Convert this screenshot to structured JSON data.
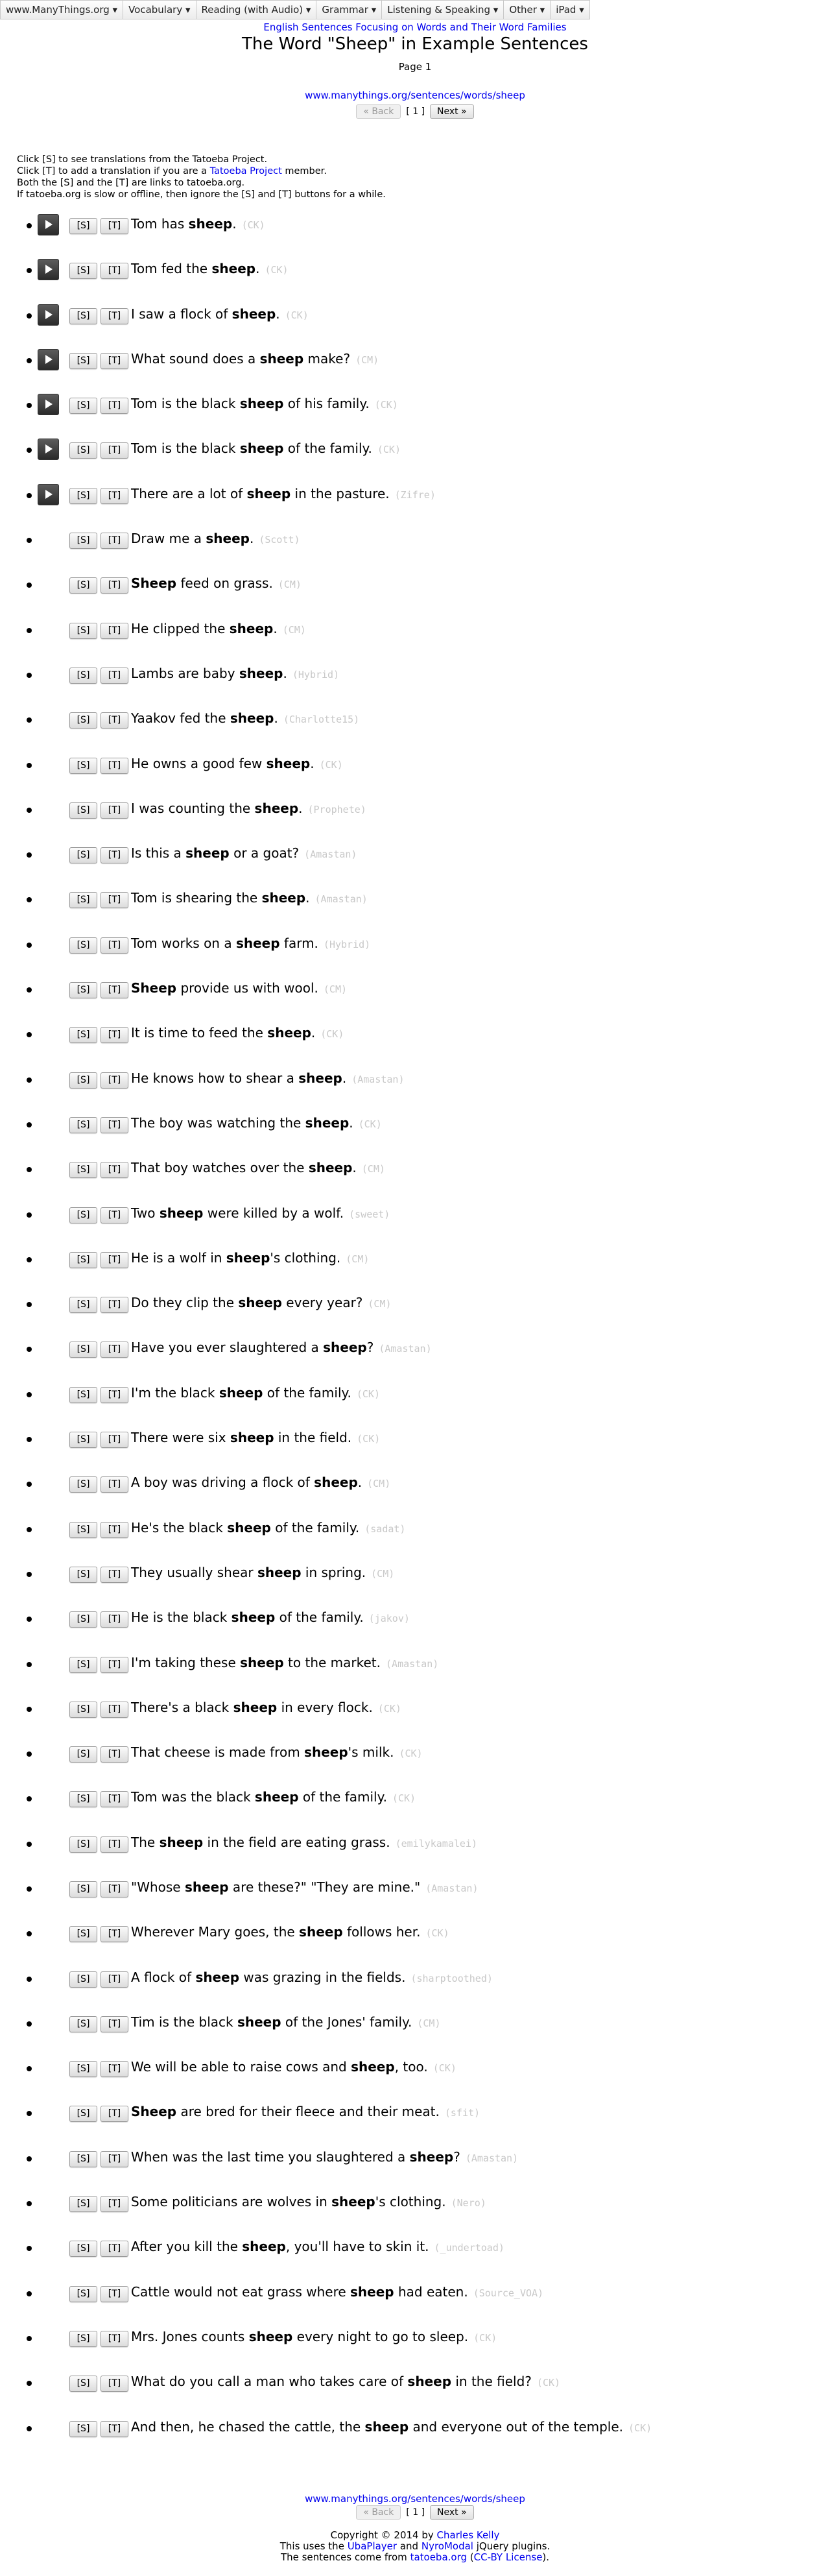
{
  "nav": [
    {
      "label": "www.ManyThings.org ▾"
    },
    {
      "label": "Vocabulary ▾"
    },
    {
      "label": "Reading (with Audio) ▾"
    },
    {
      "label": "Grammar ▾"
    },
    {
      "label": "Listening & Speaking ▾"
    },
    {
      "label": "Other ▾"
    },
    {
      "label": "iPad ▾"
    }
  ],
  "header": {
    "subtitle_link": "English Sentences Focusing on Words and Their Word Families",
    "title": "The Word \"Sheep\" in Example Sentences",
    "page": "Page 1",
    "url": "www.manythings.org/sentences/words/sheep"
  },
  "pager": {
    "back": "« Back",
    "current": "[ 1 ]",
    "next": "Next »"
  },
  "instructions": {
    "line1": "Click [S] to see translations from the Tatoeba Project.",
    "line2_pre": "Click [T] to add a translation if you are a ",
    "line2_link": "Tatoeba Project",
    "line2_post": " member.",
    "line3": "Both the [S] and the [T] are links to tatoeba.org.",
    "line4": "If tatoeba.org is slow or offline, then ignore the [S] and [T] buttons for a while."
  },
  "buttons": {
    "s": "[S]",
    "t": "[T]"
  },
  "sentences": [
    {
      "audio": true,
      "parts": [
        "Tom has ",
        "sheep",
        "."
      ],
      "author": "(CK)"
    },
    {
      "audio": true,
      "parts": [
        "Tom fed the ",
        "sheep",
        "."
      ],
      "author": "(CK)"
    },
    {
      "audio": true,
      "parts": [
        "I saw a flock of ",
        "sheep",
        "."
      ],
      "author": "(CK)"
    },
    {
      "audio": true,
      "parts": [
        "What sound does a ",
        "sheep",
        " make?"
      ],
      "author": "(CM)"
    },
    {
      "audio": true,
      "parts": [
        "Tom is the black ",
        "sheep",
        " of his family."
      ],
      "author": "(CK)"
    },
    {
      "audio": true,
      "parts": [
        "Tom is the black ",
        "sheep",
        " of the family."
      ],
      "author": "(CK)"
    },
    {
      "audio": true,
      "parts": [
        "There are a lot of ",
        "sheep",
        " in the pasture."
      ],
      "author": "(Zifre)"
    },
    {
      "audio": false,
      "parts": [
        "Draw me a ",
        "sheep",
        "."
      ],
      "author": "(Scott)"
    },
    {
      "audio": false,
      "parts": [
        "",
        "Sheep",
        " feed on grass."
      ],
      "author": "(CM)"
    },
    {
      "audio": false,
      "parts": [
        "He clipped the ",
        "sheep",
        "."
      ],
      "author": "(CM)"
    },
    {
      "audio": false,
      "parts": [
        "Lambs are baby ",
        "sheep",
        "."
      ],
      "author": "(Hybrid)"
    },
    {
      "audio": false,
      "parts": [
        "Yaakov fed the ",
        "sheep",
        "."
      ],
      "author": "(Charlotte15)"
    },
    {
      "audio": false,
      "parts": [
        "He owns a good few ",
        "sheep",
        "."
      ],
      "author": "(CK)"
    },
    {
      "audio": false,
      "parts": [
        "I was counting the ",
        "sheep",
        "."
      ],
      "author": "(Prophete)"
    },
    {
      "audio": false,
      "parts": [
        "Is this a ",
        "sheep",
        " or a goat?"
      ],
      "author": "(Amastan)"
    },
    {
      "audio": false,
      "parts": [
        "Tom is shearing the ",
        "sheep",
        "."
      ],
      "author": "(Amastan)"
    },
    {
      "audio": false,
      "parts": [
        "Tom works on a ",
        "sheep",
        " farm."
      ],
      "author": "(Hybrid)"
    },
    {
      "audio": false,
      "parts": [
        "",
        "Sheep",
        " provide us with wool."
      ],
      "author": "(CM)"
    },
    {
      "audio": false,
      "parts": [
        "It is time to feed the ",
        "sheep",
        "."
      ],
      "author": "(CK)"
    },
    {
      "audio": false,
      "parts": [
        "He knows how to shear a ",
        "sheep",
        "."
      ],
      "author": "(Amastan)"
    },
    {
      "audio": false,
      "parts": [
        "The boy was watching the ",
        "sheep",
        "."
      ],
      "author": "(CK)"
    },
    {
      "audio": false,
      "parts": [
        "That boy watches over the ",
        "sheep",
        "."
      ],
      "author": "(CM)"
    },
    {
      "audio": false,
      "parts": [
        "Two ",
        "sheep",
        " were killed by a wolf."
      ],
      "author": "(sweet)"
    },
    {
      "audio": false,
      "parts": [
        "He is a wolf in ",
        "sheep",
        "'s clothing."
      ],
      "author": "(CM)"
    },
    {
      "audio": false,
      "parts": [
        "Do they clip the ",
        "sheep",
        " every year?"
      ],
      "author": "(CM)"
    },
    {
      "audio": false,
      "parts": [
        "Have you ever slaughtered a ",
        "sheep",
        "?"
      ],
      "author": "(Amastan)"
    },
    {
      "audio": false,
      "parts": [
        "I'm the black ",
        "sheep",
        " of the family."
      ],
      "author": "(CK)"
    },
    {
      "audio": false,
      "parts": [
        "There were six ",
        "sheep",
        " in the field."
      ],
      "author": "(CK)"
    },
    {
      "audio": false,
      "parts": [
        "A boy was driving a flock of ",
        "sheep",
        "."
      ],
      "author": "(CM)"
    },
    {
      "audio": false,
      "parts": [
        "He's the black ",
        "sheep",
        " of the family."
      ],
      "author": "(sadat)"
    },
    {
      "audio": false,
      "parts": [
        "They usually shear ",
        "sheep",
        " in spring."
      ],
      "author": "(CM)"
    },
    {
      "audio": false,
      "parts": [
        "He is the black ",
        "sheep",
        " of the family."
      ],
      "author": "(jakov)"
    },
    {
      "audio": false,
      "parts": [
        "I'm taking these ",
        "sheep",
        " to the market."
      ],
      "author": "(Amastan)"
    },
    {
      "audio": false,
      "parts": [
        "There's a black ",
        "sheep",
        " in every flock."
      ],
      "author": "(CK)"
    },
    {
      "audio": false,
      "parts": [
        "That cheese is made from ",
        "sheep",
        "'s milk."
      ],
      "author": "(CK)"
    },
    {
      "audio": false,
      "parts": [
        "Tom was the black ",
        "sheep",
        " of the family."
      ],
      "author": "(CK)"
    },
    {
      "audio": false,
      "parts": [
        "The ",
        "sheep",
        " in the field are eating grass."
      ],
      "author": "(emilykamalei)"
    },
    {
      "audio": false,
      "parts": [
        "\"Whose ",
        "sheep",
        " are these?\" \"They are mine.\""
      ],
      "author": "(Amastan)"
    },
    {
      "audio": false,
      "parts": [
        "Wherever Mary goes, the ",
        "sheep",
        " follows her."
      ],
      "author": "(CK)"
    },
    {
      "audio": false,
      "parts": [
        "A flock of ",
        "sheep",
        " was grazing in the fields."
      ],
      "author": "(sharptoothed)"
    },
    {
      "audio": false,
      "parts": [
        "Tim is the black ",
        "sheep",
        " of the Jones' family."
      ],
      "author": "(CM)"
    },
    {
      "audio": false,
      "parts": [
        "We will be able to raise cows and ",
        "sheep",
        ", too."
      ],
      "author": "(CK)"
    },
    {
      "audio": false,
      "parts": [
        "",
        "Sheep",
        " are bred for their fleece and their meat."
      ],
      "author": "(sfit)"
    },
    {
      "audio": false,
      "parts": [
        "When was the last time you slaughtered a ",
        "sheep",
        "?"
      ],
      "author": "(Amastan)"
    },
    {
      "audio": false,
      "parts": [
        "Some politicians are wolves in ",
        "sheep",
        "'s clothing."
      ],
      "author": "(Nero)"
    },
    {
      "audio": false,
      "parts": [
        "After you kill the ",
        "sheep",
        ", you'll have to skin it."
      ],
      "author": "(_undertoad)"
    },
    {
      "audio": false,
      "parts": [
        "Cattle would not eat grass where ",
        "sheep",
        " had eaten."
      ],
      "author": "(Source_VOA)"
    },
    {
      "audio": false,
      "parts": [
        "Mrs. Jones counts ",
        "sheep",
        " every night to go to sleep."
      ],
      "author": "(CK)"
    },
    {
      "audio": false,
      "parts": [
        "What do you call a man who takes care of ",
        "sheep",
        " in the field?"
      ],
      "author": "(CK)"
    },
    {
      "audio": false,
      "parts": [
        "And then, he chased the cattle, the ",
        "sheep",
        " and everyone out of the temple."
      ],
      "author": "(CK)"
    }
  ],
  "footer": {
    "url": "www.manythings.org/sentences/words/sheep",
    "copyright_pre": "Copyright © 2014 by ",
    "copyright_link": "Charles Kelly",
    "plugins_pre": "This uses the ",
    "plugins_link1": "UbaPlayer",
    "plugins_mid": " and ",
    "plugins_link2": "NyroModal",
    "plugins_post": " jQuery plugins.",
    "source_pre": "The sentences come from ",
    "source_link1": "tatoeba.org",
    "source_mid": " (",
    "source_link2": "CC-BY License",
    "source_post": ")."
  }
}
